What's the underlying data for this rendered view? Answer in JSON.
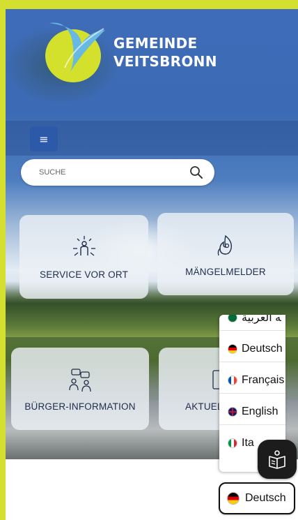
{
  "header": {
    "logo_line1": "GEMEINDE",
    "logo_line2": "VEITSBRONN"
  },
  "menu": {
    "icon": "hamburger-icon",
    "label": "≡"
  },
  "search": {
    "placeholder": "SUCHE",
    "icon": "search-icon"
  },
  "tiles": [
    {
      "label": "SERVICE VOR ORT",
      "icon": "service-people-icon"
    },
    {
      "label": "MÄNGELMELDER",
      "icon": "flame-report-icon"
    },
    {
      "label": "BÜRGER-INFORMATION",
      "icon": "citizens-chat-icon"
    },
    {
      "label": "AKTUEL",
      "icon": "news-icon"
    }
  ],
  "languages": {
    "items": [
      {
        "label": "ﻪ العربية",
        "flag": "flag-sa"
      },
      {
        "label": "Deutsch",
        "flag": "flag-de"
      },
      {
        "label": "Français",
        "flag": "flag-fr"
      },
      {
        "label": "English",
        "flag": "flag-gb"
      },
      {
        "label": "Ita",
        "flag": "flag-it"
      }
    ],
    "current": "Deutsch"
  },
  "colors": {
    "accent": "#d5df2f",
    "brand_blue": "#2d5aa8",
    "tile_text": "#1f2c4a"
  }
}
